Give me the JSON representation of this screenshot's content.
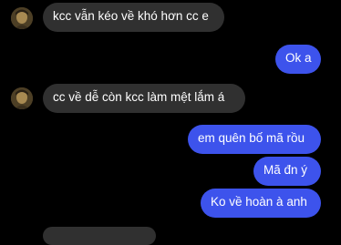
{
  "messages": [
    {
      "direction": "incoming",
      "text": "kcc vẫn kéo về khó hơn cc e"
    },
    {
      "direction": "outgoing",
      "text": "Ok a"
    },
    {
      "direction": "incoming",
      "text": "cc về dễ còn kcc làm mệt lắm á"
    },
    {
      "direction": "outgoing",
      "text": "em quên bố mã rồu"
    },
    {
      "direction": "outgoing",
      "text": "Mã đn ý"
    },
    {
      "direction": "outgoing",
      "text": "Ko về hoàn à anh"
    }
  ],
  "colors": {
    "background": "#000000",
    "incoming_bubble": "#303030",
    "outgoing_bubble": "#3d53ec",
    "text": "#ffffff"
  },
  "icons": {
    "avatar": "contact-avatar-icon"
  }
}
